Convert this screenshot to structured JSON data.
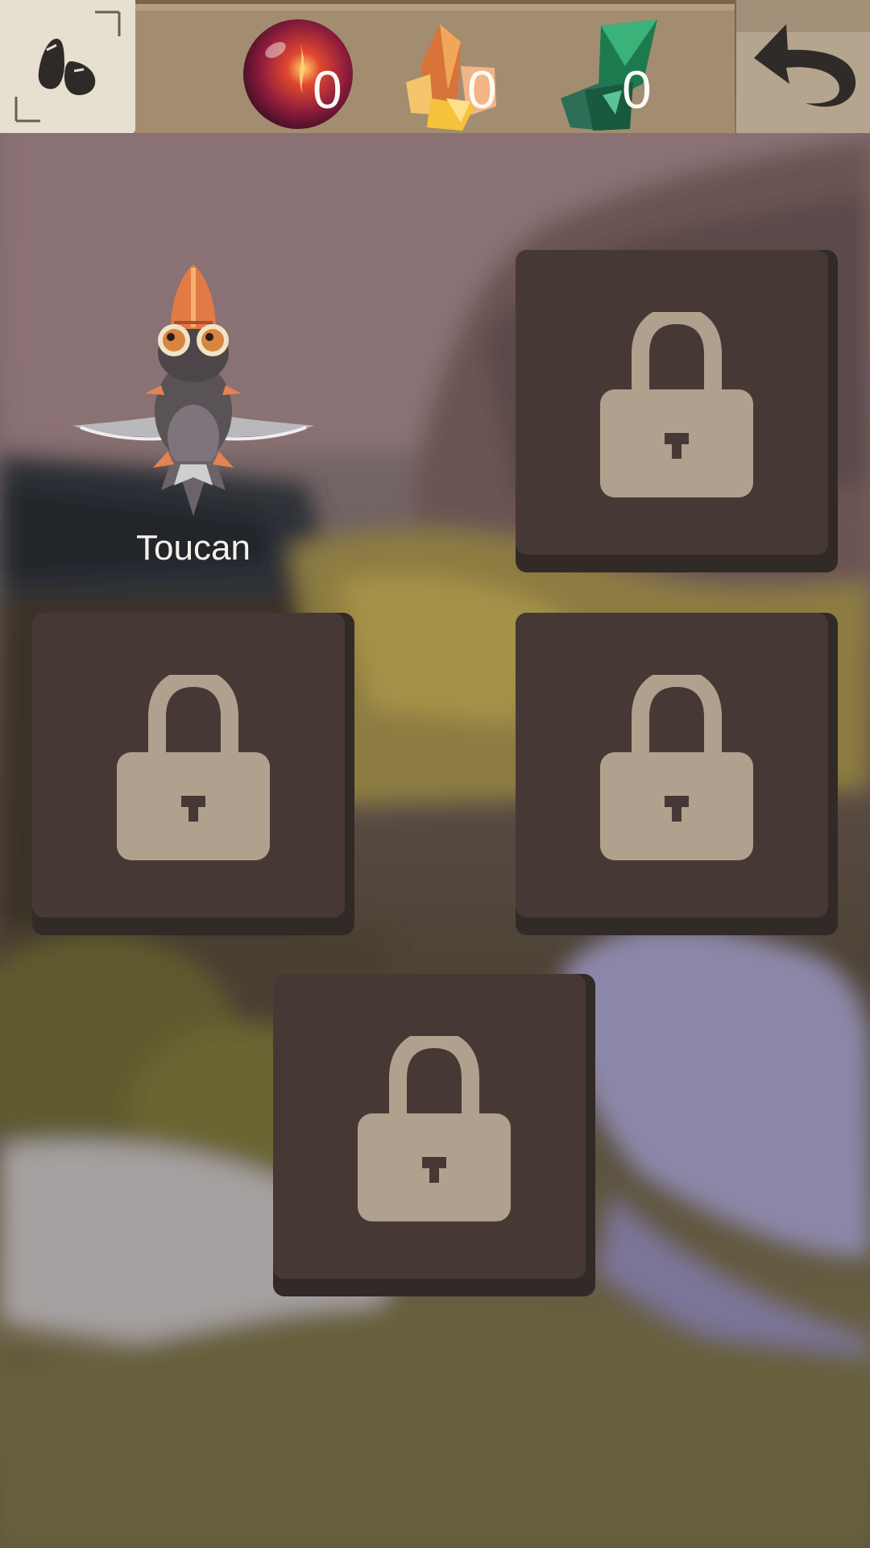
{
  "screen": "creature-collection",
  "resources": [
    {
      "name": "fire-orb",
      "count": "0",
      "color": "#b3263a"
    },
    {
      "name": "amber-crystal",
      "count": "0",
      "color": "#e59a3c"
    },
    {
      "name": "emerald-crystal",
      "count": "0",
      "color": "#1f8a5a"
    }
  ],
  "buttons": {
    "collection_icon": "stones-icon",
    "back_icon": "undo-arrow-icon"
  },
  "creatures": [
    {
      "name": "Toucan",
      "unlocked": true
    },
    {
      "name": "",
      "unlocked": false
    },
    {
      "name": "",
      "unlocked": false
    },
    {
      "name": "",
      "unlocked": false
    },
    {
      "name": "",
      "unlocked": false
    }
  ],
  "colors": {
    "card": "#463935",
    "card_shadow": "#322a27",
    "lock": "#b0a08e",
    "topbar": "#a38d70"
  }
}
